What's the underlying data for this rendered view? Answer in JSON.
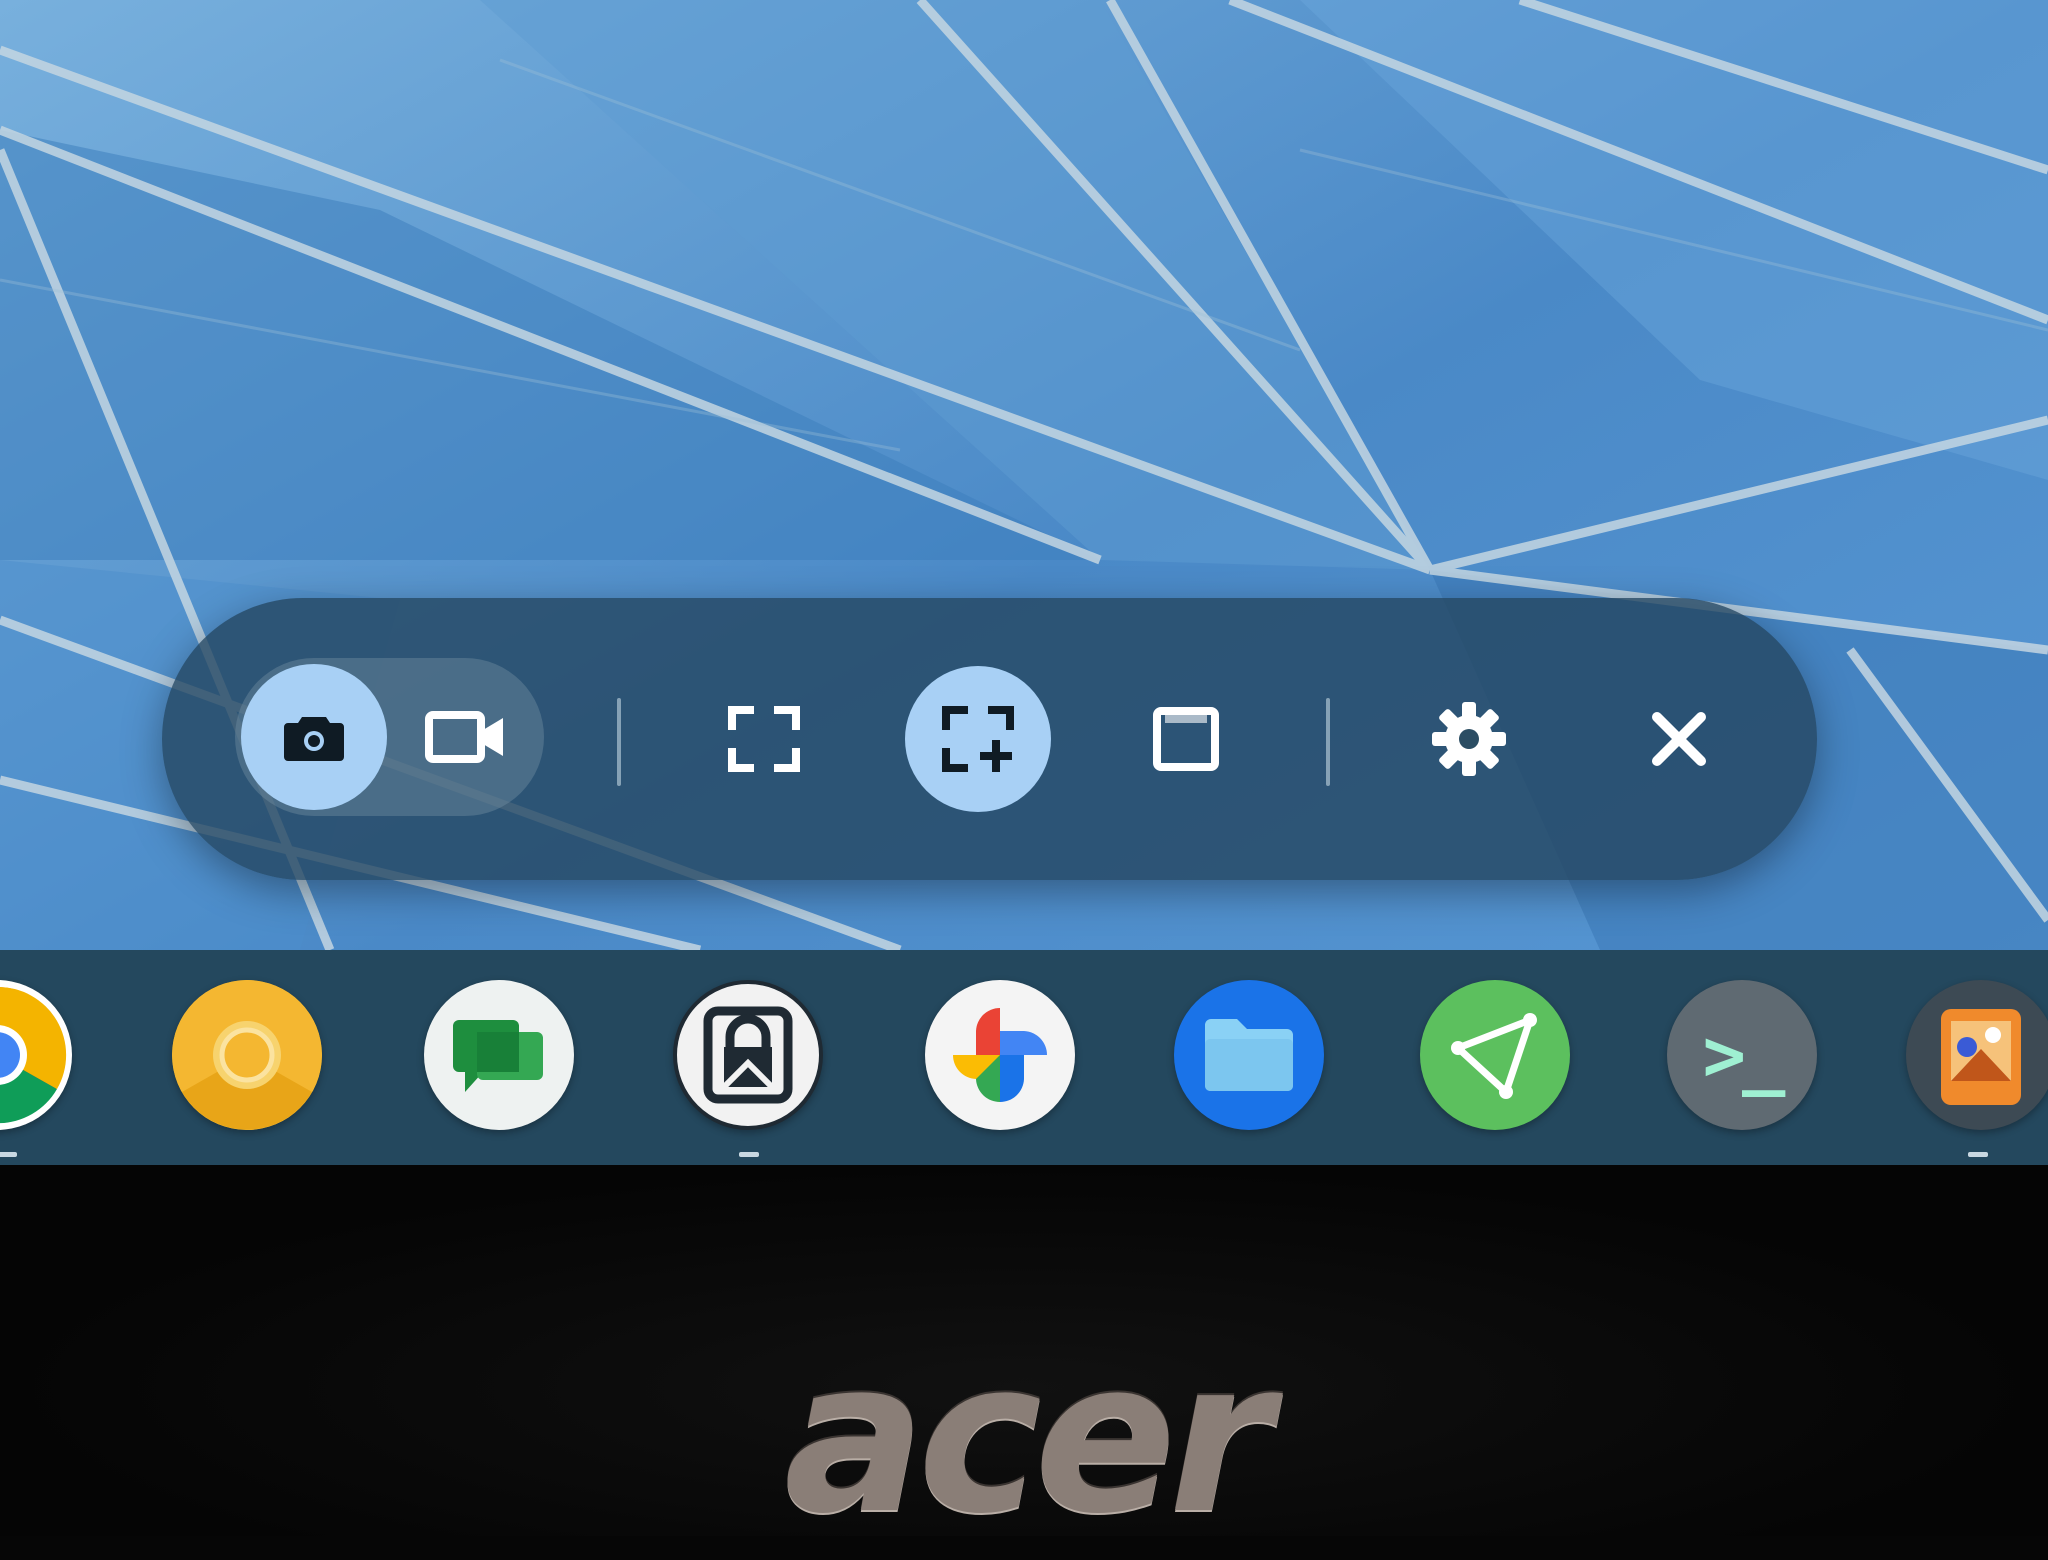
{
  "capture_bar": {
    "mode_toggle": [
      {
        "name": "screenshot",
        "icon": "camera-icon",
        "selected": true
      },
      {
        "name": "screen-record",
        "icon": "videocam-icon",
        "selected": false
      }
    ],
    "source_buttons": [
      {
        "name": "fullscreen",
        "icon": "fullscreen-icon",
        "selected": false
      },
      {
        "name": "partial",
        "icon": "partial-screen-icon",
        "selected": true
      },
      {
        "name": "window",
        "icon": "window-icon",
        "selected": false
      }
    ],
    "settings_icon": "gear-icon",
    "close_icon": "close-icon",
    "accent_color": "#a8d0f5"
  },
  "shelf": {
    "apps": [
      {
        "name": "chrome",
        "icon": "chrome-icon"
      },
      {
        "name": "chrome-canary",
        "icon": "chrome-canary-icon"
      },
      {
        "name": "google-chat",
        "icon": "chat-icon"
      },
      {
        "name": "secure-mail",
        "icon": "lock-mail-icon"
      },
      {
        "name": "google-photos",
        "icon": "photos-pinwheel-icon"
      },
      {
        "name": "files",
        "icon": "folder-icon"
      },
      {
        "name": "vectornator",
        "icon": "triangle-nodes-icon"
      },
      {
        "name": "terminal",
        "icon": "terminal-prompt-icon",
        "glyph": ">_"
      },
      {
        "name": "art-app",
        "icon": "painting-icon"
      }
    ]
  },
  "bezel": {
    "brand": "acer"
  }
}
